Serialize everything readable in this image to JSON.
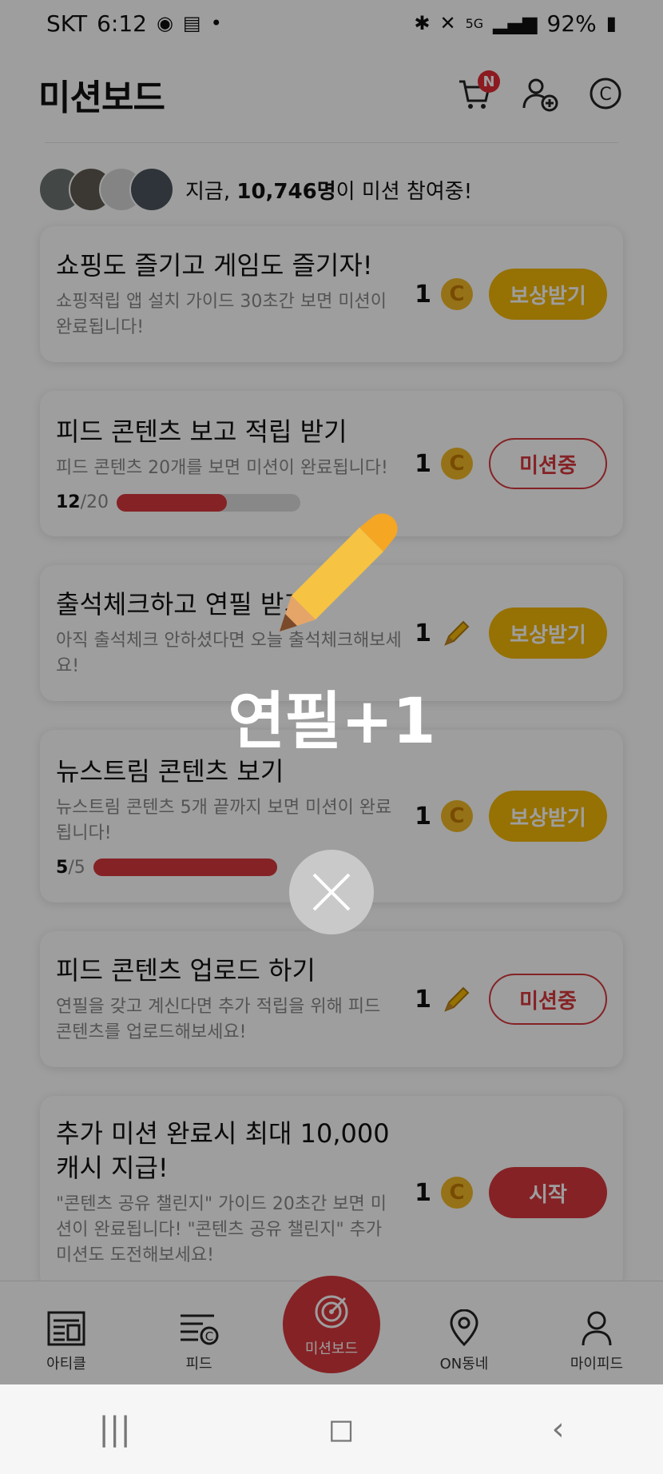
{
  "status_bar": {
    "carrier": "SKT",
    "time": "6:12",
    "battery": "92%",
    "network": "5G"
  },
  "header": {
    "title": "미션보드",
    "cart_badge": "N"
  },
  "participation": {
    "prefix": "지금,",
    "count": "10,746명",
    "suffix": "이 미션 참여중!"
  },
  "missions": [
    {
      "title": "쇼핑도 즐기고 게임도 즐기자!",
      "desc": "쇼핑적립 앱 설치 가이드 30초간 보면 미션이 완료됩니다!",
      "reward": "1",
      "reward_icon": "coin-icon",
      "coin_glyph": "C",
      "button": "보상받기",
      "button_type": "reward"
    },
    {
      "title": "피드 콘텐츠 보고 적립 받기",
      "desc": "피드 콘텐츠 20개를 보면 미션이 완료됩니다!",
      "progress_current": "12",
      "progress_total": "/20",
      "progress_fraction": 0.6,
      "reward": "1",
      "reward_icon": "coin-icon",
      "coin_glyph": "C",
      "button": "미션중",
      "button_type": "inprogress"
    },
    {
      "title": "출석체크하고 연필 받기",
      "desc": "아직 출석체크 안하셨다면 오늘 출석체크해보세요!",
      "reward": "1",
      "reward_icon": "pencil-icon",
      "button": "보상받기",
      "button_type": "reward"
    },
    {
      "title": "뉴스트림 콘텐츠 보기",
      "desc": "뉴스트림 콘텐츠 5개 끝까지 보면 미션이 완료됩니다!",
      "progress_current": "5",
      "progress_total": "/5",
      "progress_fraction": 1.0,
      "reward": "1",
      "reward_icon": "coin-icon",
      "coin_glyph": "C",
      "button": "보상받기",
      "button_type": "reward"
    },
    {
      "title": "피드 콘텐츠 업로드 하기",
      "desc": "연필을 갖고 계신다면 추가 적립을 위해 피드 콘텐츠를 업로드해보세요!",
      "reward": "1",
      "reward_icon": "pencil-icon",
      "button": "미션중",
      "button_type": "inprogress"
    },
    {
      "title": "추가 미션 완료시 최대 10,000 캐시 지급!",
      "desc": "\"콘텐츠 공유 챌린지\" 가이드 20초간 보면 미션이 완료됩니다! \"콘텐츠 공유 챌린지\" 추가 미션도 도전해보세요!",
      "reward": "1",
      "reward_icon": "coin-icon",
      "coin_glyph": "C",
      "button": "시작",
      "button_type": "start"
    }
  ],
  "tabbar": {
    "article": "아티클",
    "feed": "피드",
    "missionboard": "미션보드",
    "onneighborhood": "ON동네",
    "myfeed": "마이피드"
  },
  "popup": {
    "text": "연필+1"
  },
  "nav": {
    "recents": "|||",
    "home": "◻",
    "back": "‹"
  },
  "colors": {
    "accent_red": "#d7373d",
    "reward_yellow": "#f2b705",
    "coin": "#f1b926"
  }
}
